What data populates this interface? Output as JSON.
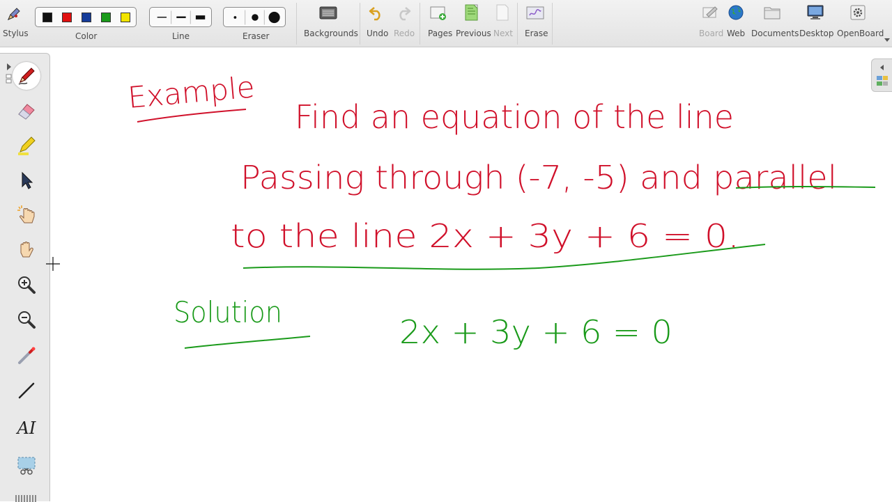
{
  "toolbar": {
    "stylus_label": "Stylus",
    "color_label": "Color",
    "line_label": "Line",
    "eraser_label": "Eraser",
    "backgrounds_label": "Backgrounds",
    "undo_label": "Undo",
    "redo_label": "Redo",
    "pages_label": "Pages",
    "previous_label": "Previous",
    "next_label": "Next",
    "erase_label": "Erase",
    "board_label": "Board",
    "web_label": "Web",
    "documents_label": "Documents",
    "desktop_label": "Desktop",
    "openboard_label": "OpenBoard",
    "colors": [
      "#111111",
      "#e01010",
      "#153c9a",
      "#1a9a1a",
      "#f2e400"
    ]
  },
  "left_dock": {
    "tools": [
      "pen-icon",
      "eraser-icon",
      "highlighter-icon",
      "selector-icon",
      "interact-hand-icon",
      "hand-icon",
      "zoom-in-icon",
      "zoom-out-icon",
      "laser-pointer-icon",
      "line-icon",
      "text-icon",
      "capture-icon"
    ],
    "text_tool_glyph": "AI"
  },
  "board": {
    "ink_red": "#d0102a",
    "ink_green": "#1a9a1a",
    "example_heading": "Example",
    "problem_line_1": "Find an equation of the line",
    "problem_line_2": "Passing through (-7, -5) and parallel",
    "problem_line_3": "to the line 2x + 3y + 6 = 0.",
    "solution_heading": "Solution",
    "solution_equation": "2x + 3y + 6 = 0"
  }
}
